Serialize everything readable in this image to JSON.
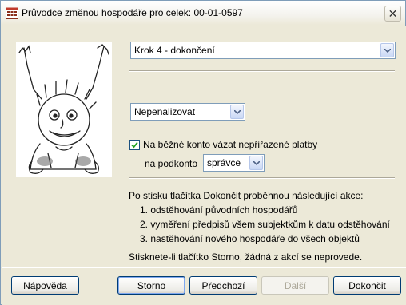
{
  "window": {
    "title": "Průvodce změnou hospodáře pro celek: 00-01-0597",
    "close_label": "✕"
  },
  "step_select": {
    "value": "Krok 4 - dokončení"
  },
  "penalty_select": {
    "value": "Nepenalizovat"
  },
  "checkbox": {
    "checked": true,
    "label": "Na běžné konto vázat nepřiřazené platby"
  },
  "subaccount": {
    "label": "na podkonto",
    "value": "správce"
  },
  "info": {
    "intro": "Po stisku tlačítka Dokončit proběhnou následující akce:",
    "items": [
      "1. odstěhování původních hospodářů",
      "2. vyměření předpisů všem subjektkům k datu odstěhování",
      "3. nastěhování nového hospodáře do všech objektů"
    ],
    "footer": "Stisknete-li tlačítko Storno, žádná z akcí se neprovede."
  },
  "buttons": {
    "help": "Nápověda",
    "cancel": "Storno",
    "previous": "Předchozí",
    "next": "Další",
    "finish": "Dokončit"
  }
}
